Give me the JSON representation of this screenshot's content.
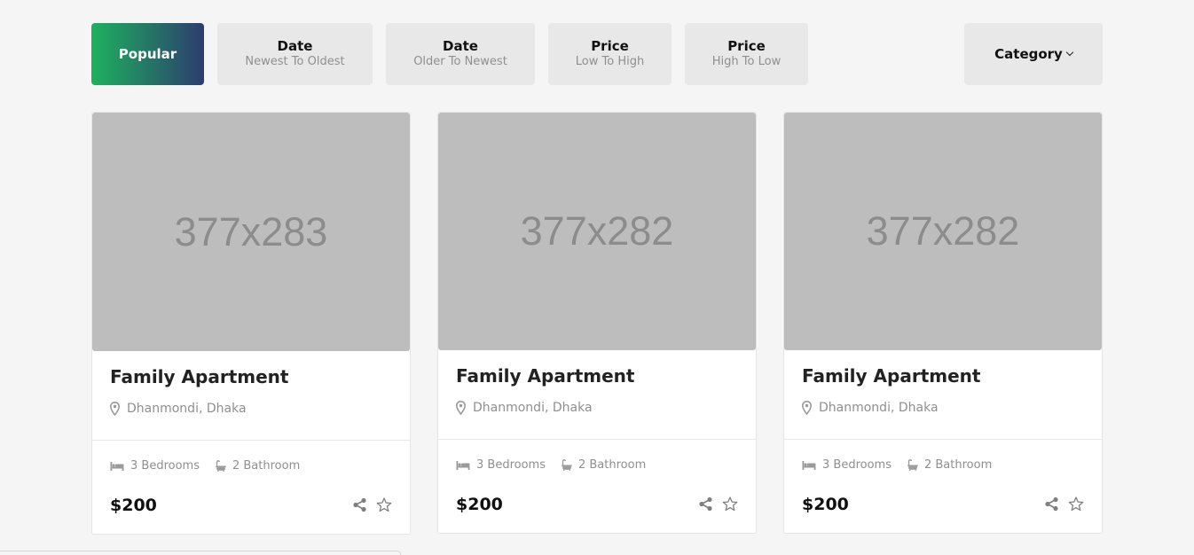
{
  "filters": {
    "popular": "Popular",
    "date_newest": {
      "title": "Date",
      "sub": "Newest To Oldest"
    },
    "date_oldest": {
      "title": "Date",
      "sub": "Older To Newest"
    },
    "price_low": {
      "title": "Price",
      "sub": "Low To High"
    },
    "price_high": {
      "title": "Price",
      "sub": "High To Low"
    },
    "category": "Category"
  },
  "cards": [
    {
      "image_text": "377x283",
      "title": "Family Apartment",
      "location": "Dhanmondi, Dhaka",
      "bedrooms": "3 Bedrooms",
      "bathrooms": "2 Bathroom",
      "price": "$200"
    },
    {
      "image_text": "377x282",
      "title": "Family Apartment",
      "location": "Dhanmondi, Dhaka",
      "bedrooms": "3 Bedrooms",
      "bathrooms": "2 Bathroom",
      "price": "$200"
    },
    {
      "image_text": "377x282",
      "title": "Family Apartment",
      "location": "Dhanmondi, Dhaka",
      "bedrooms": "3 Bedrooms",
      "bathrooms": "2 Bathroom",
      "price": "$200"
    }
  ],
  "colors": {
    "gradient_start": "#1eb15f",
    "gradient_end": "#2d3d6e",
    "button_bg": "#e8e8e8",
    "placeholder_bg": "#bdbdbd"
  },
  "icons": {
    "location": "map-pin-icon",
    "bed": "bed-icon",
    "bath": "bathtub-icon",
    "share": "share-icon",
    "favorite": "star-outline-icon",
    "dropdown": "chevron-down-icon"
  }
}
